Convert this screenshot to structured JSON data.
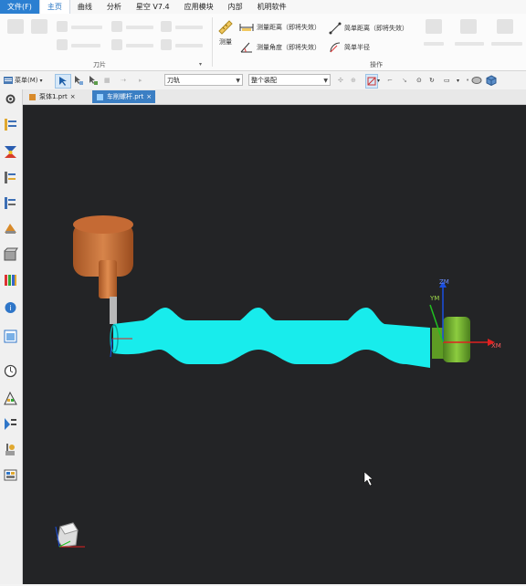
{
  "menubar": {
    "items": [
      "文件(F)",
      "主页",
      "曲线",
      "分析",
      "星空 V7.4",
      "应用模块",
      "内部",
      "机明软件"
    ]
  },
  "ribbon": {
    "measure_label": "测量",
    "tools": [
      "测量距离（即将失效）",
      "测量角度（即将失效）",
      "简单距离（即将失效）",
      "简单半径"
    ],
    "groups": [
      "刀片",
      "操作"
    ]
  },
  "toolbar": {
    "menu_label": "菜单(M)",
    "filter_value": "刀轨",
    "assembly_value": "整个装配"
  },
  "tabs": [
    {
      "label": "泵体1.prt",
      "close": "×"
    },
    {
      "label": "车削螺杆.prt",
      "close": "×"
    }
  ],
  "viewport": {
    "axes": {
      "y": "YM",
      "z": "ZM",
      "x": "XM"
    }
  },
  "colors": {
    "file_menu": "#2b7fd1",
    "active_tab": "#3b7fc4",
    "viewport_bg": "#232426",
    "part": "#18ecec",
    "tool_holder": "#c96f32",
    "chuck": "#74b531"
  }
}
